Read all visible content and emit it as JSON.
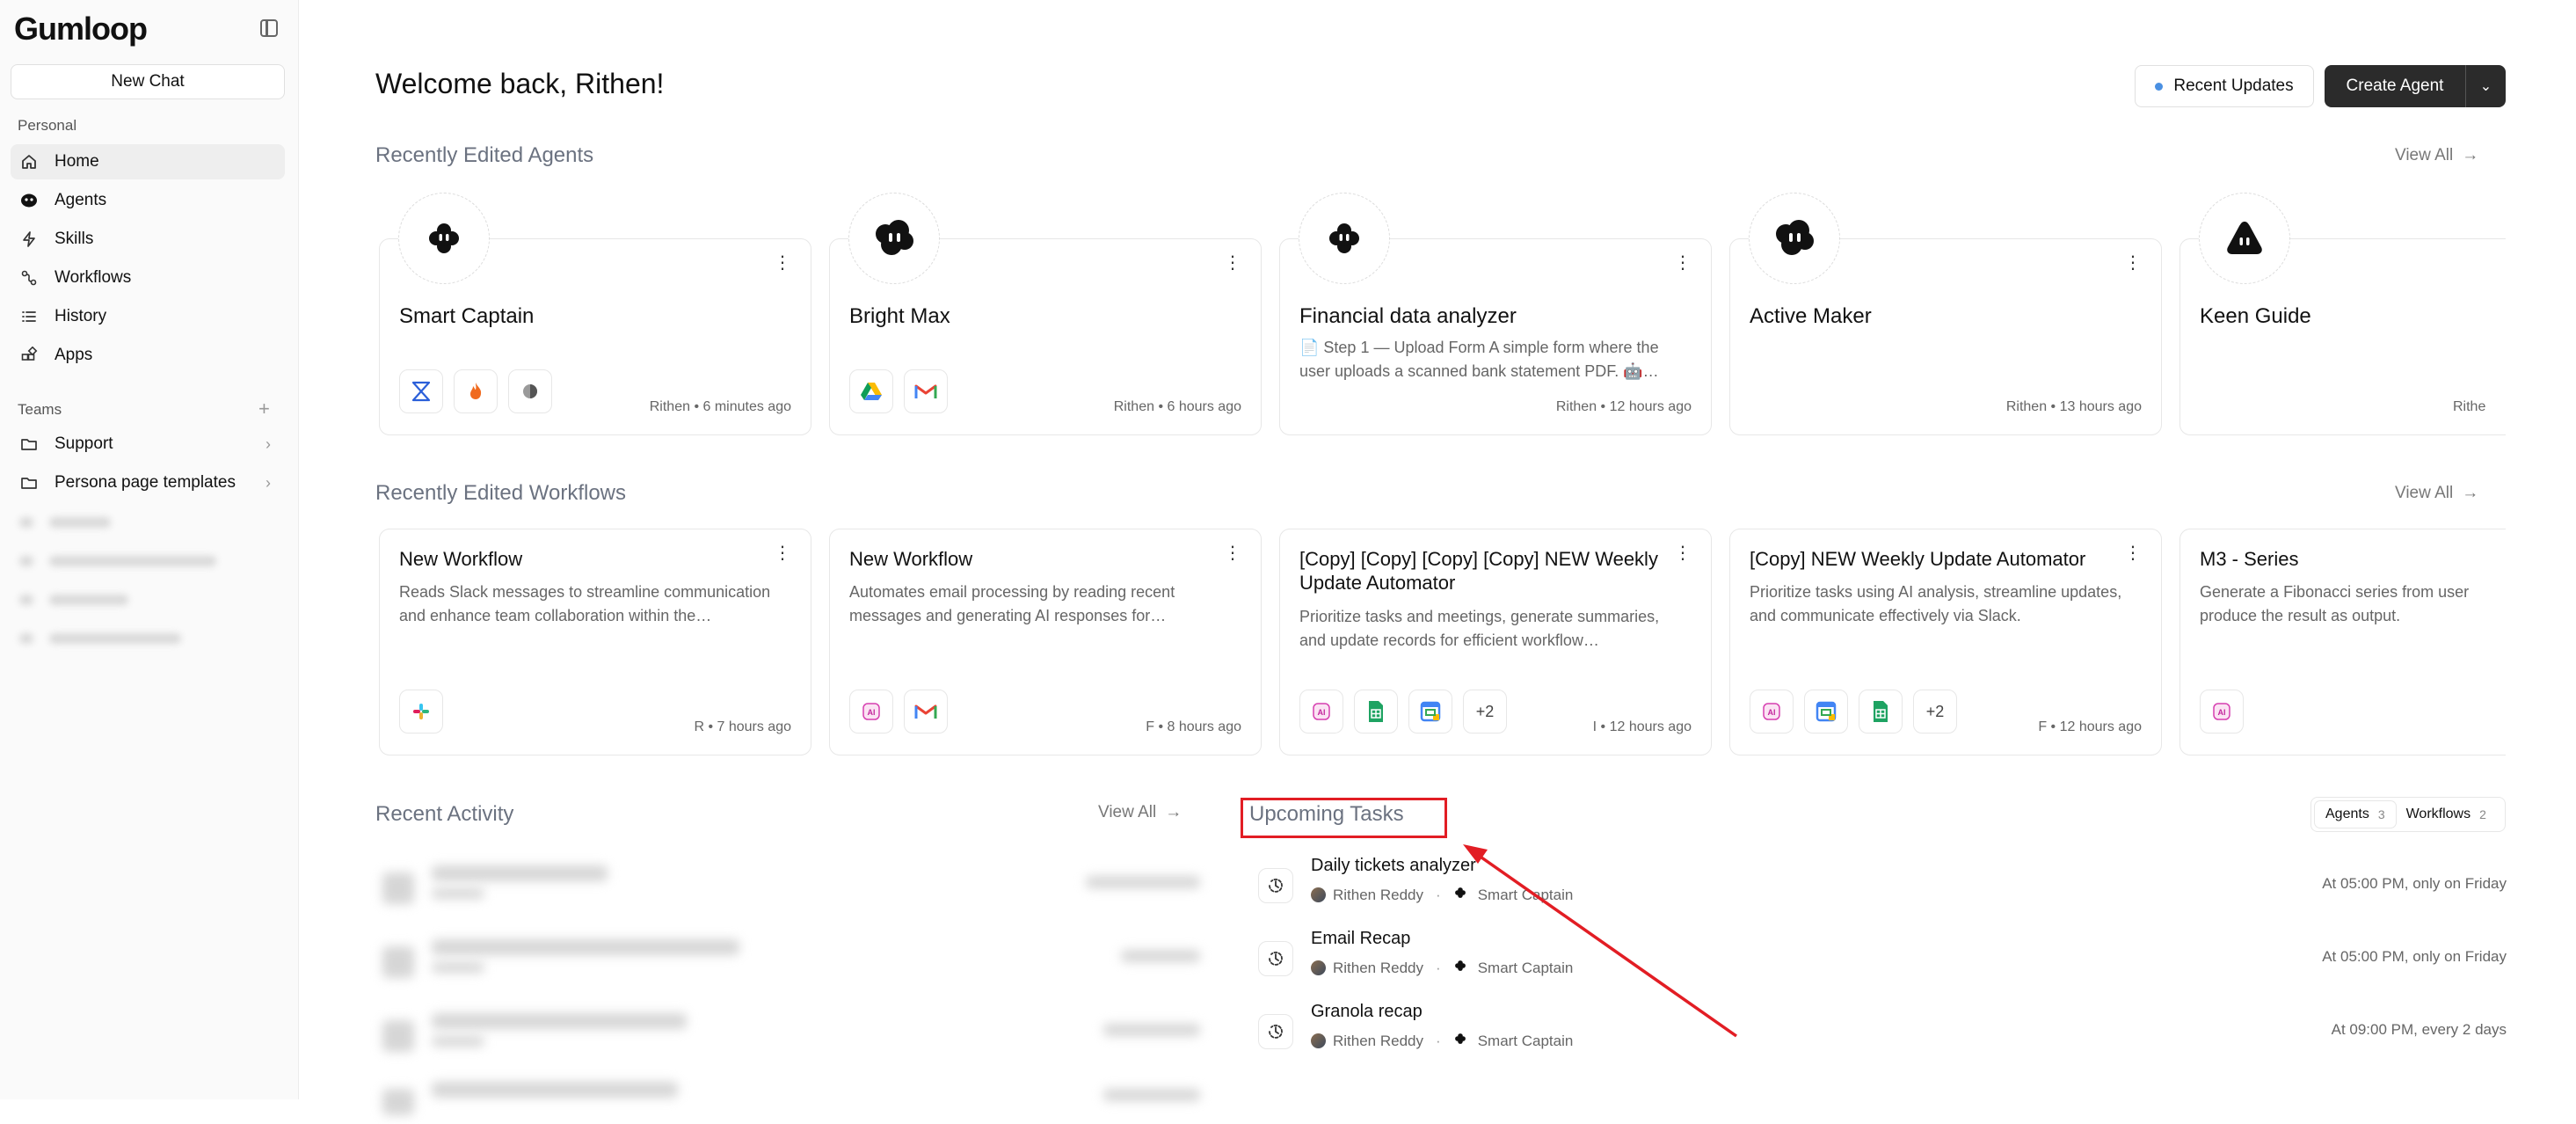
{
  "sidebar": {
    "logo": "Gumloop",
    "new_chat": "New Chat",
    "personal_label": "Personal",
    "items": [
      {
        "label": "Home",
        "icon": "home-icon"
      },
      {
        "label": "Agents",
        "icon": "agent-icon"
      },
      {
        "label": "Skills",
        "icon": "bolt-icon"
      },
      {
        "label": "Workflows",
        "icon": "workflow-icon"
      },
      {
        "label": "History",
        "icon": "list-icon"
      },
      {
        "label": "Apps",
        "icon": "apps-icon"
      }
    ],
    "teams_label": "Teams",
    "teams": [
      {
        "label": "Support",
        "icon": "folder-icon"
      },
      {
        "label": "Persona page templates",
        "icon": "folder-icon"
      }
    ]
  },
  "header": {
    "welcome": "Welcome back, Rithen!",
    "recent_updates": "Recent Updates",
    "create_agent": "Create Agent"
  },
  "agents_section": {
    "title": "Recently Edited Agents",
    "view_all": "View All",
    "cards": [
      {
        "name": "Smart Captain",
        "desc": "",
        "meta": "Rithen • 6 minutes ago",
        "integrations": [
          "rippling-icon",
          "firecrawl-icon",
          "perplexity-icon"
        ]
      },
      {
        "name": "Bright Max",
        "desc": "",
        "meta": "Rithen • 6 hours ago",
        "integrations": [
          "google-drive-icon",
          "gmail-icon"
        ]
      },
      {
        "name": "Financial data analyzer",
        "desc": "📄 Step 1 — Upload Form A simple form where the user uploads a scanned bank statement PDF. 🤖…",
        "meta": "Rithen • 12 hours ago",
        "integrations": []
      },
      {
        "name": "Active Maker",
        "desc": "",
        "meta": "Rithen • 13 hours ago",
        "integrations": []
      },
      {
        "name": "Keen Guide",
        "desc": "",
        "meta": "Rithe",
        "integrations": []
      }
    ]
  },
  "workflows_section": {
    "title": "Recently Edited Workflows",
    "view_all": "View All",
    "cards": [
      {
        "name": "New Workflow",
        "desc": "Reads Slack messages to streamline communication and enhance team collaboration within the…",
        "meta": "R • 7 hours ago",
        "integrations": [
          "slack-icon"
        ]
      },
      {
        "name": "New Workflow",
        "desc": "Automates email processing by reading recent messages and generating AI responses for…",
        "meta": "F • 8 hours ago",
        "integrations": [
          "ai-icon",
          "gmail-icon"
        ]
      },
      {
        "name": "[Copy] [Copy] [Copy] [Copy] NEW Weekly Update Automator",
        "desc": "Prioritize tasks and meetings, generate summaries, and update records for efficient workflow…",
        "meta": "I • 12 hours ago",
        "integrations": [
          "ai-icon",
          "google-sheets-icon",
          "google-calendar-icon"
        ],
        "more": "+2"
      },
      {
        "name": "[Copy] NEW Weekly Update Automator",
        "desc": "Prioritize tasks using AI analysis, streamline updates, and communicate effectively via Slack.",
        "meta": "F • 12 hours ago",
        "integrations": [
          "ai-icon",
          "google-calendar-icon",
          "google-sheets-icon"
        ],
        "more": "+2"
      },
      {
        "name": "M3 - Series",
        "desc": "Generate a Fibonacci series from user produce the result as output.",
        "meta": "",
        "integrations": [
          "ai-icon"
        ]
      }
    ]
  },
  "activity_section": {
    "title": "Recent Activity",
    "view_all": "View All"
  },
  "tasks_section": {
    "title": "Upcoming Tasks",
    "tabs": [
      {
        "label": "Agents",
        "count": "3"
      },
      {
        "label": "Workflows",
        "count": "2"
      }
    ],
    "tasks": [
      {
        "name": "Daily tickets analyzer",
        "owner": "Rithen Reddy",
        "agent": "Smart Captain",
        "when": "At 05:00 PM, only on Friday"
      },
      {
        "name": "Email Recap",
        "owner": "Rithen Reddy",
        "agent": "Smart Captain",
        "when": "At 05:00 PM, only on Friday"
      },
      {
        "name": "Granola recap",
        "owner": "Rithen Reddy",
        "agent": "Smart Captain",
        "when": "At 09:00 PM, every 2 days"
      }
    ]
  },
  "colors": {
    "accent": "#2b2b2b",
    "highlight": "#e21d24",
    "dot": "#4a90e2"
  }
}
